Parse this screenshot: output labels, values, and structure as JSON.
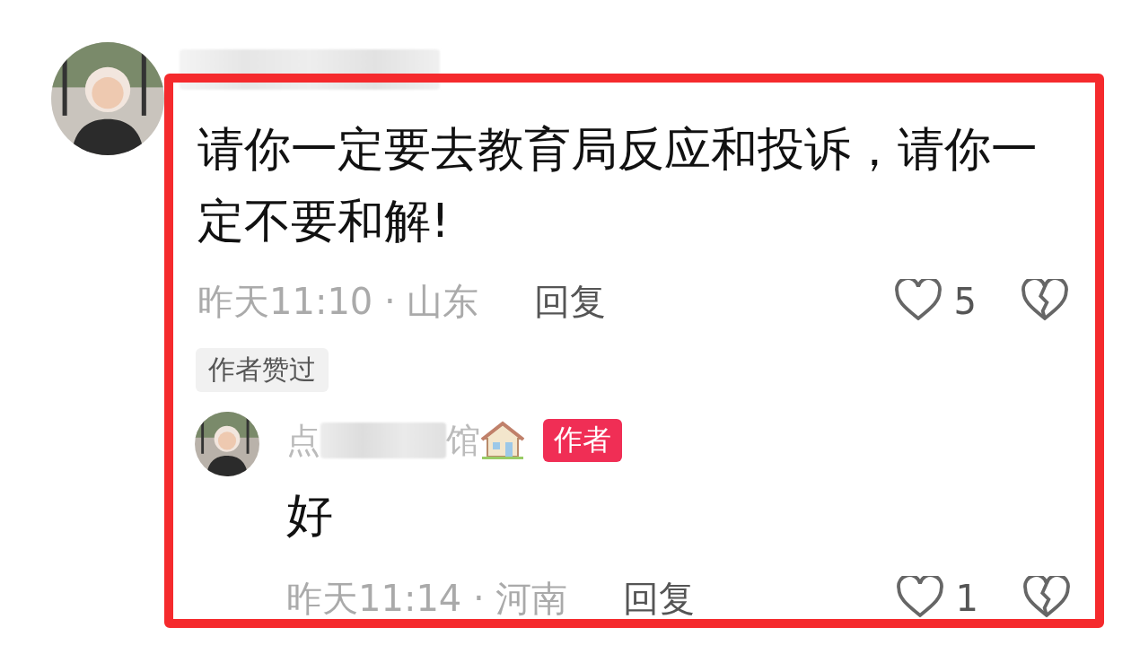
{
  "comment": {
    "text": "请你一定要去教育局反应和投诉，请你一定不要和解!",
    "meta": "昨天11:10 · 山东",
    "reply_label": "回复",
    "likes": "5",
    "liked": false,
    "tag": "作者赞过"
  },
  "reply": {
    "author_start": "点",
    "author_end": "馆",
    "badge": "作者",
    "text": "好",
    "meta": "昨天11:14 · 河南",
    "reply_label": "回复",
    "likes": "1",
    "liked": false
  },
  "highlight": {
    "on": true
  }
}
